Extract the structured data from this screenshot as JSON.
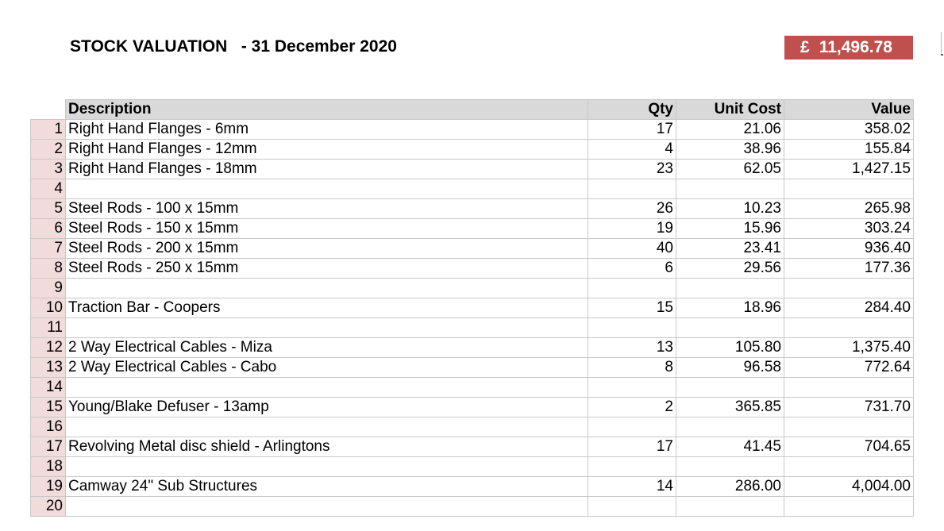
{
  "header": {
    "title": "STOCK VALUATION   - 31 December 2020",
    "total_currency": "£",
    "total_value": "11,496.78",
    "total_badge_color": "#c0504d"
  },
  "table": {
    "columns": {
      "description": "Description",
      "qty": "Qty",
      "unit_cost": "Unit Cost",
      "value": "Value"
    },
    "rows": [
      {
        "num": "1",
        "description": "Right Hand Flanges - 6mm",
        "qty": "17",
        "unit_cost": "21.06",
        "value": "358.02"
      },
      {
        "num": "2",
        "description": "Right Hand Flanges - 12mm",
        "qty": "4",
        "unit_cost": "38.96",
        "value": "155.84"
      },
      {
        "num": "3",
        "description": "Right Hand Flanges - 18mm",
        "qty": "23",
        "unit_cost": "62.05",
        "value": "1,427.15"
      },
      {
        "num": "4",
        "description": "",
        "qty": "",
        "unit_cost": "",
        "value": ""
      },
      {
        "num": "5",
        "description": "Steel Rods - 100 x 15mm",
        "qty": "26",
        "unit_cost": "10.23",
        "value": "265.98"
      },
      {
        "num": "6",
        "description": "Steel Rods - 150 x 15mm",
        "qty": "19",
        "unit_cost": "15.96",
        "value": "303.24"
      },
      {
        "num": "7",
        "description": "Steel Rods - 200 x 15mm",
        "qty": "40",
        "unit_cost": "23.41",
        "value": "936.40"
      },
      {
        "num": "8",
        "description": "Steel Rods - 250 x 15mm",
        "qty": "6",
        "unit_cost": "29.56",
        "value": "177.36"
      },
      {
        "num": "9",
        "description": "",
        "qty": "",
        "unit_cost": "",
        "value": ""
      },
      {
        "num": "10",
        "description": "Traction Bar - Coopers",
        "qty": "15",
        "unit_cost": "18.96",
        "value": "284.40"
      },
      {
        "num": "11",
        "description": "",
        "qty": "",
        "unit_cost": "",
        "value": ""
      },
      {
        "num": "12",
        "description": "2 Way Electrical Cables - Miza",
        "qty": "13",
        "unit_cost": "105.80",
        "value": "1,375.40"
      },
      {
        "num": "13",
        "description": "2 Way Electrical Cables - Cabo",
        "qty": "8",
        "unit_cost": "96.58",
        "value": "772.64"
      },
      {
        "num": "14",
        "description": "",
        "qty": "",
        "unit_cost": "",
        "value": ""
      },
      {
        "num": "15",
        "description": "Young/Blake Defuser - 13amp",
        "qty": "2",
        "unit_cost": "365.85",
        "value": "731.70"
      },
      {
        "num": "16",
        "description": "",
        "qty": "",
        "unit_cost": "",
        "value": ""
      },
      {
        "num": "17",
        "description": "Revolving Metal disc shield - Arlingtons",
        "qty": "17",
        "unit_cost": "41.45",
        "value": "704.65"
      },
      {
        "num": "18",
        "description": "",
        "qty": "",
        "unit_cost": "",
        "value": ""
      },
      {
        "num": "19",
        "description": "Camway 24\" Sub Structures",
        "qty": "14",
        "unit_cost": "286.00",
        "value": "4,004.00"
      },
      {
        "num": "20",
        "description": "",
        "qty": "",
        "unit_cost": "",
        "value": ""
      }
    ]
  }
}
